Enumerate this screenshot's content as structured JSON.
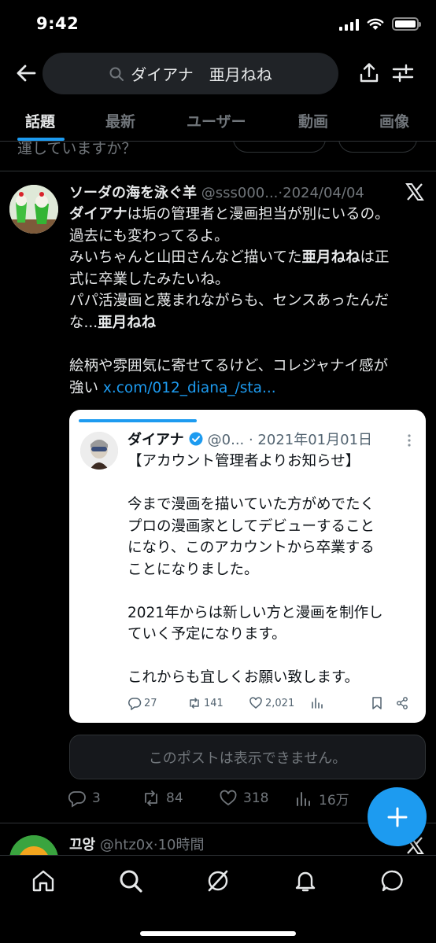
{
  "status_bar": {
    "time": "9:42"
  },
  "search": {
    "query": "ダイアナ　亜月ねね"
  },
  "tabs": [
    {
      "label": "話題",
      "active": true
    },
    {
      "label": "最新"
    },
    {
      "label": "ユーザー"
    },
    {
      "label": "動画"
    },
    {
      "label": "画像"
    }
  ],
  "previous_post": {
    "text_fragment": "運していますか？"
  },
  "post": {
    "author_name": "ソーダの海を泳ぐ羊",
    "meta": "@sss000...·2024/04/04",
    "body_lines": [
      {
        "pre": "",
        "bold": "ダイアナ",
        "post": "は垢の管理者と漫画担当が別にいるの。"
      },
      {
        "pre": "過去にも変わってるよ。",
        "bold": "",
        "post": ""
      },
      {
        "pre": "みいちゃんと山田さんなど描いてた",
        "bold": "亜月ねね",
        "post": "は正"
      },
      {
        "pre": "式に卒業したみたいね。",
        "bold": "",
        "post": ""
      },
      {
        "pre": "パパ活漫画と蔑まれながらも、センスあったんだ",
        "bold": "",
        "post": ""
      },
      {
        "pre": "な...",
        "bold": "亜月ねね",
        "post": ""
      },
      {
        "pre": "",
        "bold": "",
        "post": ""
      },
      {
        "pre": "絵柄や雰囲気に寄せてるけど、コレジャナイ感が",
        "bold": "",
        "post": ""
      }
    ],
    "last_line_prefix": "強い ",
    "link": "x.com/012_diana_/sta...",
    "quoted": {
      "name": "ダイアナ",
      "meta": "@0...  · 2021年01月01日",
      "lines": [
        "【アカウント管理者よりお知らせ】",
        "",
        "今まで漫画を描いていた方がめでたく",
        "プロの漫画家としてデビューすること",
        "になり、このアカウントから卒業する",
        "ことになりました。",
        "",
        "2021年からは新しい方と漫画を制作し",
        "ていく予定になります。",
        "",
        "これからも宜しくお願い致します。"
      ],
      "replies": "27",
      "reposts": "141",
      "likes": "2,021"
    },
    "unavailable_text": "このポストは表示できません。",
    "replies": "3",
    "reposts": "84",
    "likes": "318",
    "views": "16万"
  },
  "next_post": {
    "author_name": "끄앙",
    "meta": "@htz0x·10時間"
  },
  "colors": {
    "accent": "#1d9bf0",
    "background": "#000000",
    "muted": "#71767b"
  }
}
